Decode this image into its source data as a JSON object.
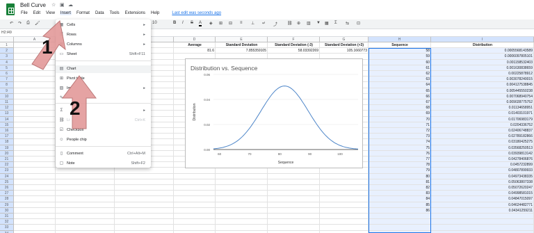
{
  "app": {
    "title": "Bell Curve",
    "last_edit": "Last edit was seconds ago",
    "menus": [
      "File",
      "Edit",
      "View",
      "Insert",
      "Format",
      "Data",
      "Tools",
      "Extensions",
      "Help"
    ]
  },
  "toolbar": {
    "font_size": "10",
    "bold": "B",
    "italic": "I",
    "strike": "S",
    "text_color": "A"
  },
  "formula_bar": {
    "name_box": "H2:I49"
  },
  "columns": [
    "A",
    "B",
    "C",
    "D",
    "E",
    "F",
    "G",
    "H",
    "I",
    "J"
  ],
  "rows": [
    "1",
    "2",
    "3",
    "4",
    "5",
    "6",
    "7",
    "8",
    "9",
    "10",
    "11",
    "12",
    "13",
    "14",
    "15",
    "16",
    "17",
    "18",
    "19",
    "20",
    "21",
    "22",
    "23",
    "24",
    "25",
    "26",
    "27",
    "28",
    "29",
    "30",
    "31",
    "32",
    "33",
    "34"
  ],
  "sheet": {
    "header_partial_b": "Std",
    "headers": {
      "d": "Average",
      "e": "Standard Deviation",
      "f": "Standard Deviation (-3)",
      "g": "Standard Deviation (+3)",
      "h": "Sequence",
      "i": "Distribution"
    },
    "row2": {
      "d": "81.6",
      "e": "7.855359105",
      "f": "58.03392269",
      "g": "105.1660773"
    },
    "sequence": [
      "58",
      "59",
      "60",
      "61",
      "62",
      "63",
      "64",
      "65",
      "66",
      "67",
      "68",
      "69",
      "70",
      "71",
      "72",
      "73",
      "74",
      "75",
      "76",
      "77",
      "78",
      "79",
      "80",
      "81",
      "82",
      "83",
      "84",
      "85",
      "86"
    ],
    "distribution": [
      "0.0005568143589",
      "0.0006097805101",
      "0.001158532403",
      "0.001630838659",
      "0.00225878912",
      "0.003078240015",
      "0.004127538845",
      "0.005445550238",
      "0.007068940754",
      "0.009028775752",
      "0.01134658951",
      "0.01403101971",
      "0.01706983179",
      "0.0204336752",
      "0.02406748837",
      "0.02789182866",
      "0.03180425275",
      "0.03568250513",
      "0.03939813142",
      "0.04278406876",
      "0.0457232899",
      "0.04807899933",
      "0.04973438335",
      "0.05063807338",
      "0.05072620247",
      "0.04998581015",
      "0.04847015097",
      "0.04624482771",
      "0.04341259211"
    ]
  },
  "insert_menu": {
    "items": [
      {
        "icon": "cells-icon",
        "label": "Cells",
        "shortcut": "",
        "submenu": true
      },
      {
        "icon": "rows-icon",
        "label": "Rows",
        "shortcut": "",
        "submenu": true
      },
      {
        "icon": "columns-icon",
        "label": "Columns",
        "shortcut": "",
        "submenu": true
      },
      {
        "icon": "sheet-icon",
        "label": "Sheet",
        "shortcut": "Shift+F11",
        "submenu": false
      },
      {
        "icon": "chart-icon",
        "label": "Chart",
        "shortcut": "",
        "submenu": false
      },
      {
        "icon": "pivot-table-icon",
        "label": "Pivot table",
        "shortcut": "",
        "submenu": false
      },
      {
        "icon": "image-icon",
        "label": "Im",
        "shortcut": "",
        "submenu": true
      },
      {
        "icon": "drawing-icon",
        "label": "",
        "shortcut": "",
        "submenu": false
      },
      {
        "icon": "function-icon",
        "label": "",
        "shortcut": "",
        "submenu": true
      },
      {
        "icon": "link-icon",
        "label": "Li",
        "shortcut": "Ctrl+K",
        "submenu": false
      },
      {
        "icon": "checkbox-icon",
        "label": "Checkbox",
        "shortcut": "",
        "submenu": false
      },
      {
        "icon": "people-chip-icon",
        "label": "People chip",
        "shortcut": "",
        "submenu": false
      },
      {
        "icon": "comment-icon",
        "label": "Comment",
        "shortcut": "Ctrl+Alt+M",
        "submenu": false
      },
      {
        "icon": "note-icon",
        "label": "Note",
        "shortcut": "Shift+F2",
        "submenu": false
      }
    ]
  },
  "chart_data": {
    "type": "line",
    "title": "Distribution vs. Sequence",
    "xlabel": "Sequence",
    "ylabel": "Distribution",
    "xlim": [
      58,
      106
    ],
    "ylim": [
      0,
      0.06
    ],
    "xticks": [
      "60",
      "70",
      "80",
      "90",
      "100"
    ],
    "yticks": [
      "0.00",
      "0.02",
      "0.04",
      "0.06"
    ],
    "mean": 81.6,
    "sd": 7.855359105,
    "series": [
      {
        "color": "#4e86c9"
      }
    ]
  },
  "annotations": [
    {
      "label": "1",
      "color": "#e8a4a4"
    },
    {
      "label": "2",
      "color": "#e8a4a4"
    }
  ],
  "colors": {
    "accent": "#1a73e8",
    "logo": "#188038",
    "selection": "#e8f0fe"
  }
}
